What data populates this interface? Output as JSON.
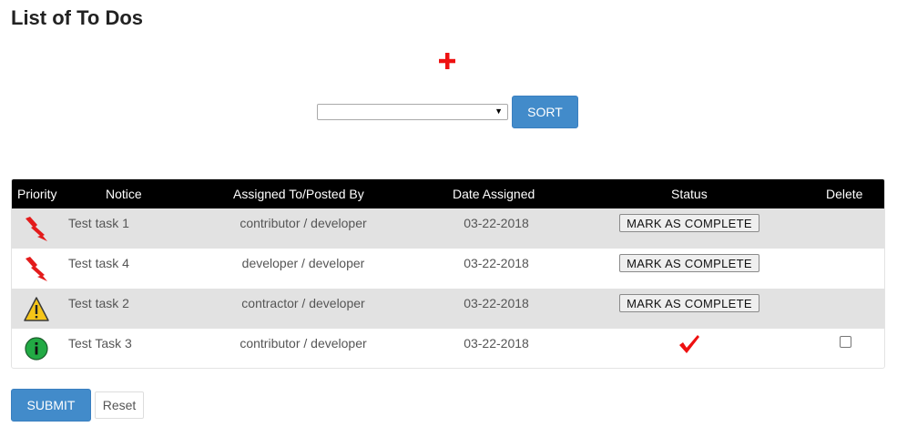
{
  "page": {
    "title": "List of To Dos"
  },
  "toolbar": {
    "add_icon": "plus-icon",
    "sort_select_value": "",
    "sort_label": "SORT"
  },
  "table": {
    "headers": [
      "Priority",
      "Notice",
      "Assigned To/Posted By",
      "Date Assigned",
      "Status",
      "Delete"
    ],
    "rows": [
      {
        "priority_icon": "lightning-icon",
        "notice": "Test task 1",
        "assigned": "contributor / developer",
        "date": "03-22-2018",
        "status": "MARK AS COMPLETE"
      },
      {
        "priority_icon": "lightning-icon",
        "notice": "Test task 4",
        "assigned": "developer / developer",
        "date": "03-22-2018",
        "status": "MARK AS COMPLETE"
      },
      {
        "priority_icon": "warning-icon",
        "notice": "Test task 2",
        "assigned": "contractor / developer",
        "date": "03-22-2018",
        "status": "MARK AS COMPLETE"
      },
      {
        "priority_icon": "info-icon",
        "notice": "Test Task 3",
        "assigned": "contributor / developer",
        "date": "03-22-2018",
        "status_icon": "checkmark-icon"
      }
    ]
  },
  "form": {
    "submit_label": "SUBMIT",
    "reset_label": "Reset"
  },
  "colors": {
    "primary": "#428bca",
    "header_bg": "#000000",
    "row_shade": "#e2e2e2",
    "plus_red": "#ee1111",
    "check_red": "#ee1111",
    "info_green": "#22aa44",
    "warning_yellow": "#f5c518"
  }
}
